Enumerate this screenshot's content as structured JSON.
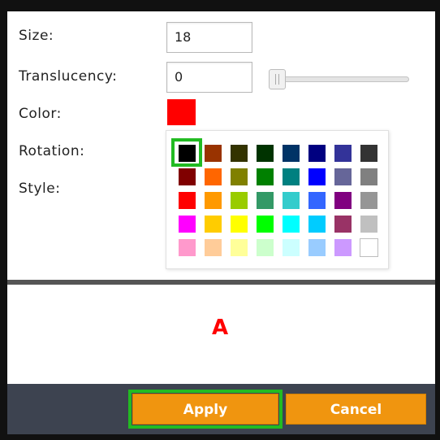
{
  "form": {
    "size_label": "Size:",
    "size_value": "18",
    "translucency_label": "Translucency:",
    "translucency_value": "0",
    "translucency_slider": 0,
    "color_label": "Color:",
    "color_value": "#ff0000",
    "rotation_label": "Rotation:",
    "style_label": "Style:"
  },
  "palette": {
    "selected": "#000000",
    "rows": [
      [
        "#000000",
        "#993300",
        "#333300",
        "#003300",
        "#003366",
        "#000080",
        "#333399",
        "#333333"
      ],
      [
        "#800000",
        "#ff6600",
        "#808000",
        "#008000",
        "#008080",
        "#0000ff",
        "#666699",
        "#808080"
      ],
      [
        "#ff0000",
        "#ff9900",
        "#99cc00",
        "#339966",
        "#33cccc",
        "#3366ff",
        "#800080",
        "#969696"
      ],
      [
        "#ff00ff",
        "#ffcc00",
        "#ffff00",
        "#00ff00",
        "#00ffff",
        "#00ccff",
        "#993366",
        "#c0c0c0"
      ],
      [
        "#ff99cc",
        "#ffcc99",
        "#ffff99",
        "#ccffcc",
        "#ccffff",
        "#99ccff",
        "#cc99ff",
        "#ffffff"
      ]
    ]
  },
  "preview": {
    "text": "A",
    "color": "#ff0000"
  },
  "footer": {
    "apply_label": "Apply",
    "cancel_label": "Cancel"
  }
}
